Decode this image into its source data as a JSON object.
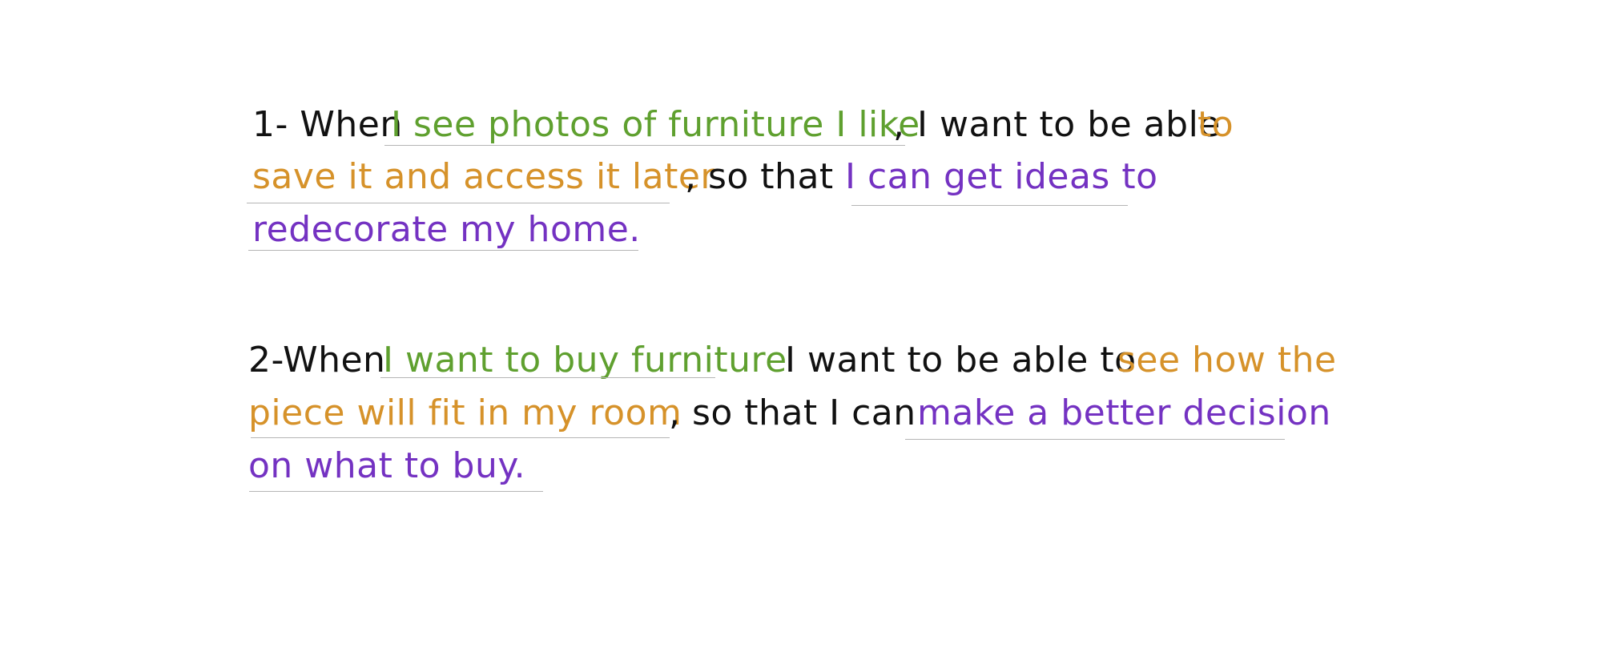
{
  "stories": [
    {
      "number": "1- When",
      "situation": "I see photos of furniture I like",
      "comma": ",",
      "want": "I want to be able",
      "motivation_a": "to",
      "motivation_b": "save it and access it later",
      "so_that": ", so that",
      "outcome_a": "I can get ideas to",
      "outcome_b": "redecorate my home."
    },
    {
      "number": "2-When",
      "situation": "I want to buy furniture",
      "want": "I want to be able to",
      "motivation_a": "see how the",
      "motivation_b": "piece will fit in my room",
      "so_that": ", so that I can",
      "outcome_a": "make a better decision",
      "outcome_b": "on what to buy."
    }
  ],
  "colors": {
    "text": "#111111",
    "situation": "#5fa02f",
    "motivation": "#d6922a",
    "outcome": "#7432c2",
    "underline": "#b5b5b5"
  }
}
